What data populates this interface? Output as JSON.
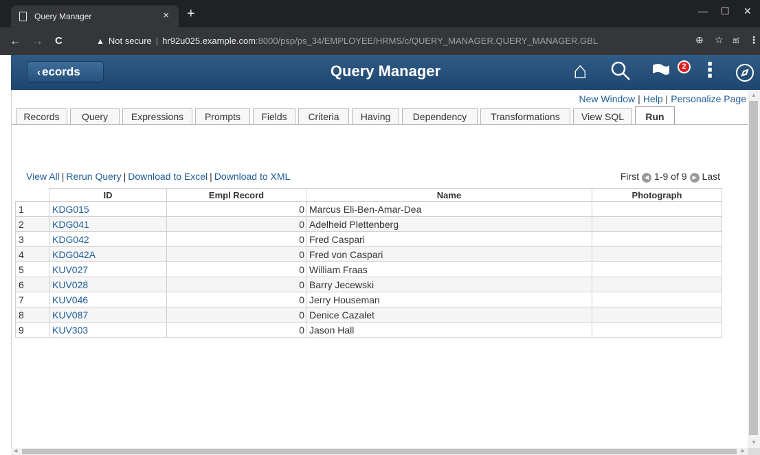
{
  "browser": {
    "tab_title": "Query Manager",
    "tab_close": "×",
    "new_tab": "+",
    "minimize": "—",
    "maximize": "☐",
    "close": "✕",
    "back": "←",
    "forward": "→",
    "reload": "C",
    "security_icon": "▲",
    "security_text": "Not secure",
    "separator": "|",
    "url_host": "hr92u025.example.com",
    "url_path": ":8000/psp/ps_34/EMPLOYEE/HRMS/c/QUERY_MANAGER.QUERY_MANAGER.GBL",
    "zoom_icon": "⊕",
    "star_icon": "☆",
    "ext_icon": "ಹ",
    "menu_icon": "⋮"
  },
  "banner": {
    "back_chevron": "‹",
    "back_label": "ecords",
    "title": "Query Manager",
    "home_icon": "⌂",
    "search_icon": "⚲",
    "flag_icon": "⚑",
    "notification_count": "2",
    "actions_icon": "⋮"
  },
  "toplinks": {
    "new_window": "New Window",
    "help": "Help",
    "personalize": "Personalize Page",
    "separator": "|"
  },
  "tabs": [
    {
      "label": "Records"
    },
    {
      "label": "Query"
    },
    {
      "label": "Expressions"
    },
    {
      "label": "Prompts"
    },
    {
      "label": "Fields"
    },
    {
      "label": "Criteria"
    },
    {
      "label": "Having"
    },
    {
      "label": "Dependency"
    },
    {
      "label": "Transformations"
    },
    {
      "label": "View SQL"
    },
    {
      "label": "Run"
    }
  ],
  "grid_links": {
    "view_all": "View All",
    "rerun": "Rerun Query",
    "excel": "Download to Excel",
    "xml": "Download to XML",
    "separator": "|"
  },
  "pager": {
    "first": "First",
    "range": "1-9 of 9",
    "last": "Last",
    "prev_icon": "◀",
    "next_icon": "▶"
  },
  "columns": {
    "id": "ID",
    "empl_record": "Empl Record",
    "name": "Name",
    "photograph": "Photograph"
  },
  "rows": [
    {
      "n": "1",
      "id": "KDG015",
      "empl": "0",
      "name": "Marcus Eli-Ben-Amar-Dea",
      "photo": ""
    },
    {
      "n": "2",
      "id": "KDG041",
      "empl": "0",
      "name": "Adelheid Plettenberg",
      "photo": ""
    },
    {
      "n": "3",
      "id": "KDG042",
      "empl": "0",
      "name": "Fred Caspari",
      "photo": ""
    },
    {
      "n": "4",
      "id": "KDG042A",
      "empl": "0",
      "name": "Fred von Caspari",
      "photo": ""
    },
    {
      "n": "5",
      "id": "KUV027",
      "empl": "0",
      "name": "William Fraas",
      "photo": ""
    },
    {
      "n": "6",
      "id": "KUV028",
      "empl": "0",
      "name": "Barry Jecewski",
      "photo": ""
    },
    {
      "n": "7",
      "id": "KUV046",
      "empl": "0",
      "name": "Jerry Houseman",
      "photo": ""
    },
    {
      "n": "8",
      "id": "KUV087",
      "empl": "0",
      "name": "Denice Cazalet",
      "photo": ""
    },
    {
      "n": "9",
      "id": "KUV303",
      "empl": "0",
      "name": "Jason Hall",
      "photo": ""
    }
  ],
  "scroll": {
    "up": "▲",
    "down": "▼",
    "left": "◀",
    "right": "▶"
  },
  "colors": {
    "banner": "#1e466f",
    "link": "#1f5c99"
  }
}
